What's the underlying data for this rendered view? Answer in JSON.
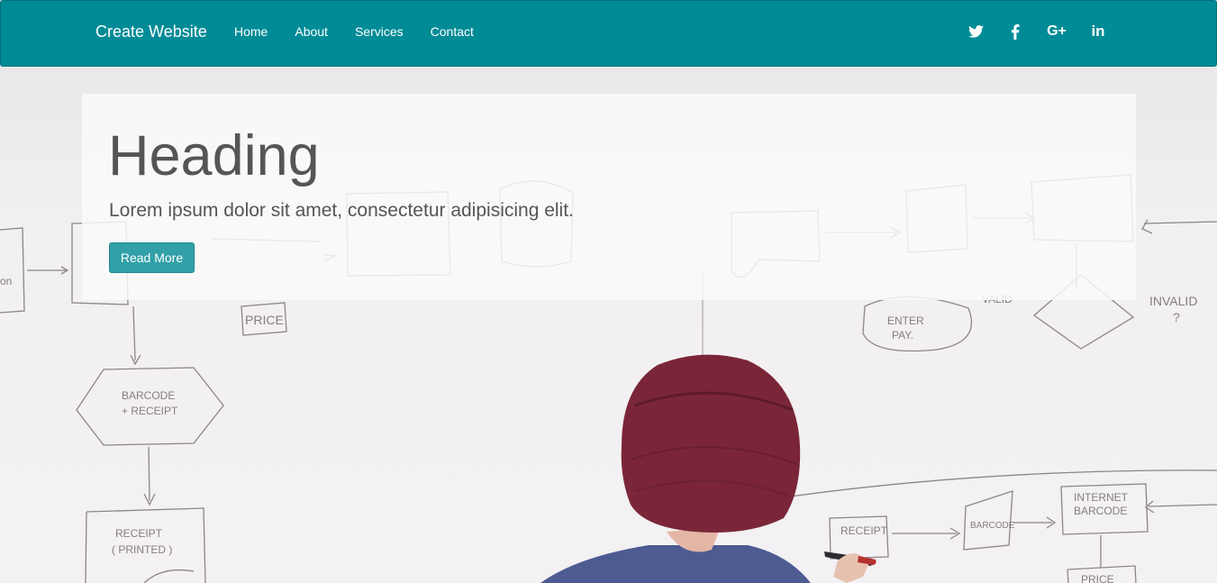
{
  "navbar": {
    "brand": "Create Website",
    "links": [
      "Home",
      "About",
      "Services",
      "Contact"
    ],
    "social": [
      "twitter-icon",
      "facebook-icon",
      "google-plus-icon",
      "linkedin-icon"
    ],
    "google_plus_label": "G+",
    "linkedin_label": "in",
    "background": "#008b96"
  },
  "hero": {
    "heading": "Heading",
    "lead": "Lorem ipsum dolor sit amet, consectetur adipisicing elit.",
    "button_label": "Read More",
    "button_color": "#31a0a8"
  },
  "background_image": {
    "description_texts": [
      "RECEIPT",
      "PRICE",
      "BARCODE + RECEIPT",
      "RECEIPT PRINTED",
      "ENTER PAY",
      "VALID",
      "INVALID ?",
      "INTERNET BARCODE",
      "BARCODE",
      "RECEIPT",
      "INTERNET BARCODE",
      "BARCODE"
    ]
  }
}
